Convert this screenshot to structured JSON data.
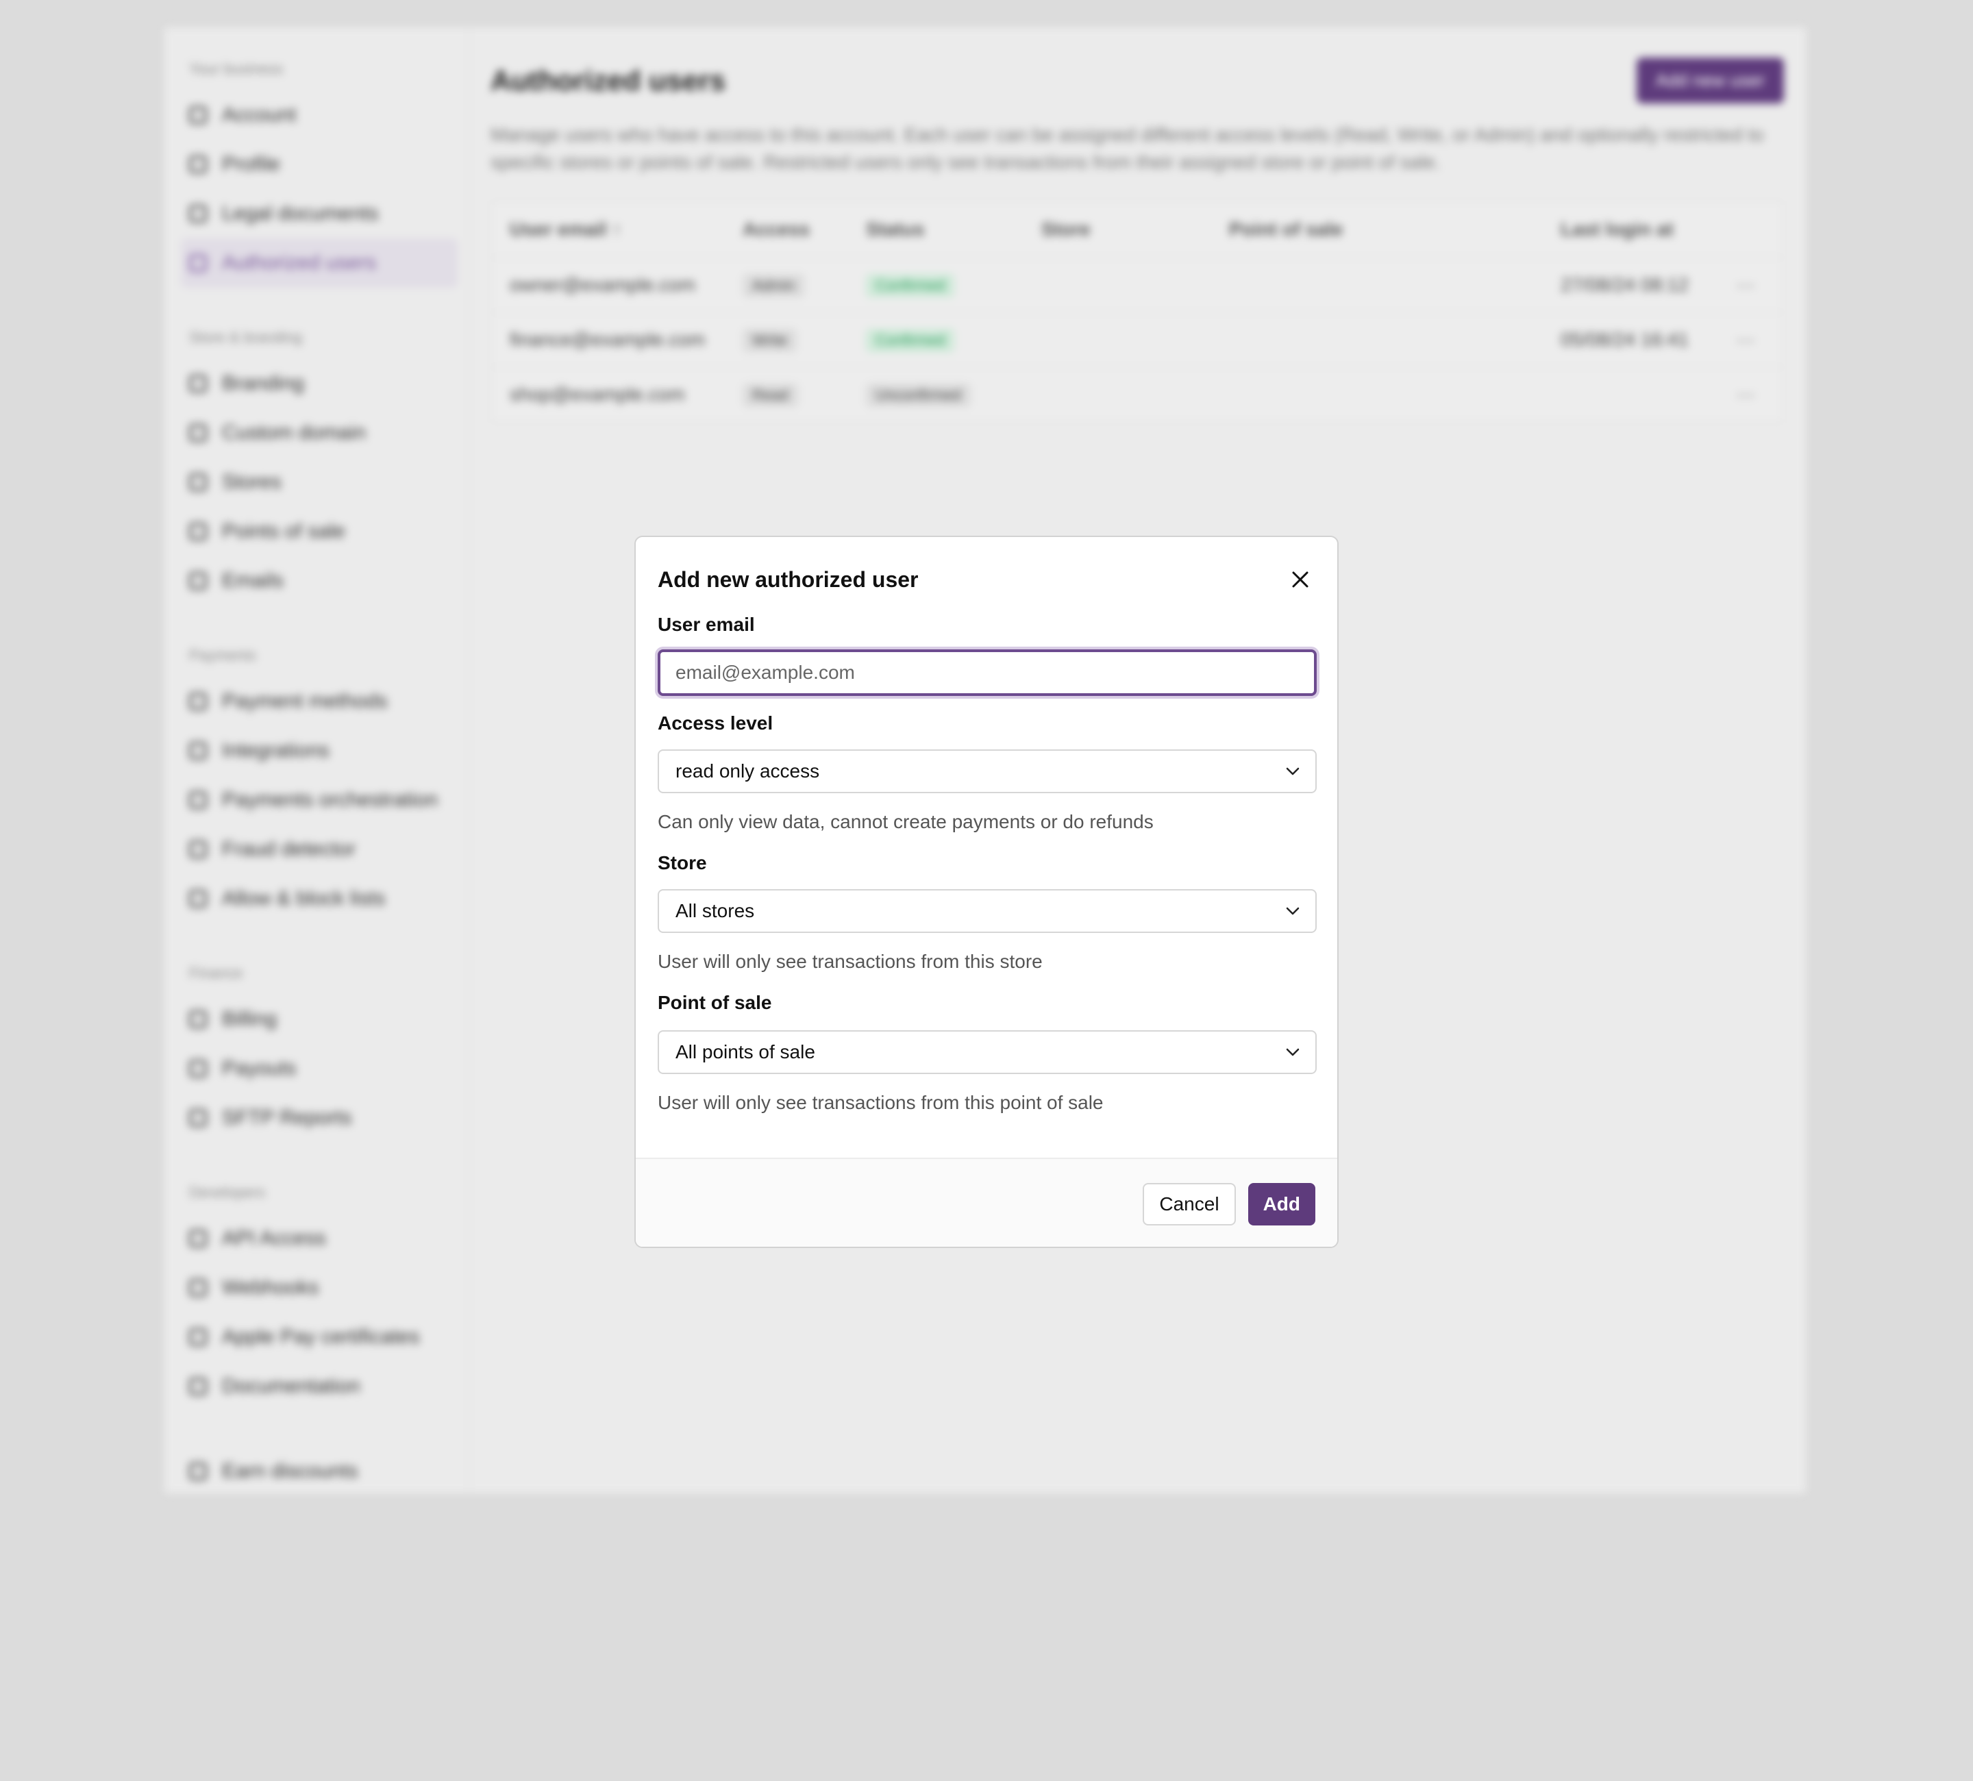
{
  "background": {
    "sidebar": [
      {
        "heading": "Your business",
        "items": [
          {
            "label": "Account",
            "icon": "account-icon"
          },
          {
            "label": "Profile",
            "icon": "profile-icon"
          },
          {
            "label": "Legal documents",
            "icon": "document-icon"
          },
          {
            "label": "Authorized users",
            "icon": "users-icon",
            "active": true
          }
        ]
      },
      {
        "heading": "Store & branding",
        "items": [
          {
            "label": "Branding",
            "icon": "brush-icon"
          },
          {
            "label": "Custom domain",
            "icon": "globe-icon"
          },
          {
            "label": "Stores",
            "icon": "store-icon"
          },
          {
            "label": "Points of sale",
            "icon": "pos-icon"
          },
          {
            "label": "Emails",
            "icon": "mail-icon"
          }
        ]
      },
      {
        "heading": "Payments",
        "items": [
          {
            "label": "Payment methods",
            "icon": "card-icon"
          },
          {
            "label": "Integrations",
            "icon": "grid-icon"
          },
          {
            "label": "Payments orchestration",
            "icon": "flow-icon"
          },
          {
            "label": "Fraud detector",
            "icon": "shield-icon"
          },
          {
            "label": "Allow & block lists",
            "icon": "list-icon"
          }
        ]
      },
      {
        "heading": "Finance",
        "items": [
          {
            "label": "Billing",
            "icon": "billing-icon"
          },
          {
            "label": "Payouts",
            "icon": "payout-icon"
          },
          {
            "label": "SFTP Reports",
            "icon": "report-icon"
          }
        ]
      },
      {
        "heading": "Developers",
        "items": [
          {
            "label": "API Access",
            "icon": "key-icon"
          },
          {
            "label": "Webhooks",
            "icon": "webhook-icon"
          },
          {
            "label": "Apple Pay certificates",
            "icon": "apple-icon"
          },
          {
            "label": "Documentation",
            "icon": "code-icon"
          }
        ]
      },
      {
        "heading": "",
        "items": [
          {
            "label": "Earn discounts",
            "icon": "gift-icon"
          }
        ]
      }
    ],
    "main": {
      "title": "Authorized users",
      "add_button": "Add new user",
      "description": "Manage users who have access to this account. Each user can be assigned different access levels (Read, Write, or Admin) and optionally restricted to specific stores or points of sale. Restricted users only see transactions from their assigned store or point of sale.",
      "columns": [
        "User email ↑",
        "Access",
        "Status",
        "Store",
        "Point of sale",
        "Last login at",
        ""
      ],
      "rows": [
        [
          "owner@example.com",
          "Admin",
          "Confirmed",
          "",
          "",
          "27/08/24 08:12",
          "···"
        ],
        [
          "finance@example.com",
          "Write",
          "Confirmed",
          "",
          "",
          "05/08/24 16:41",
          "···"
        ],
        [
          "shop@example.com",
          "Read",
          "Unconfirmed",
          "",
          "",
          "",
          "···"
        ]
      ]
    }
  },
  "modal": {
    "title": "Add new authorized user",
    "email": {
      "label": "User email",
      "placeholder": "email@example.com",
      "value": ""
    },
    "access": {
      "label": "Access level",
      "selected": "read only access",
      "hint": "Can only view data, cannot create payments or do refunds"
    },
    "store": {
      "label": "Store",
      "selected": "All stores",
      "hint": "User will only see transactions from this store"
    },
    "pos": {
      "label": "Point of sale",
      "selected": "All points of sale",
      "hint": "User will only see transactions from this point of sale"
    },
    "cancel_label": "Cancel",
    "add_label": "Add"
  },
  "colors": {
    "accent": "#5e3b7c",
    "focus_ring": "#d9cde5",
    "confirmed": "#2a9a5a"
  }
}
